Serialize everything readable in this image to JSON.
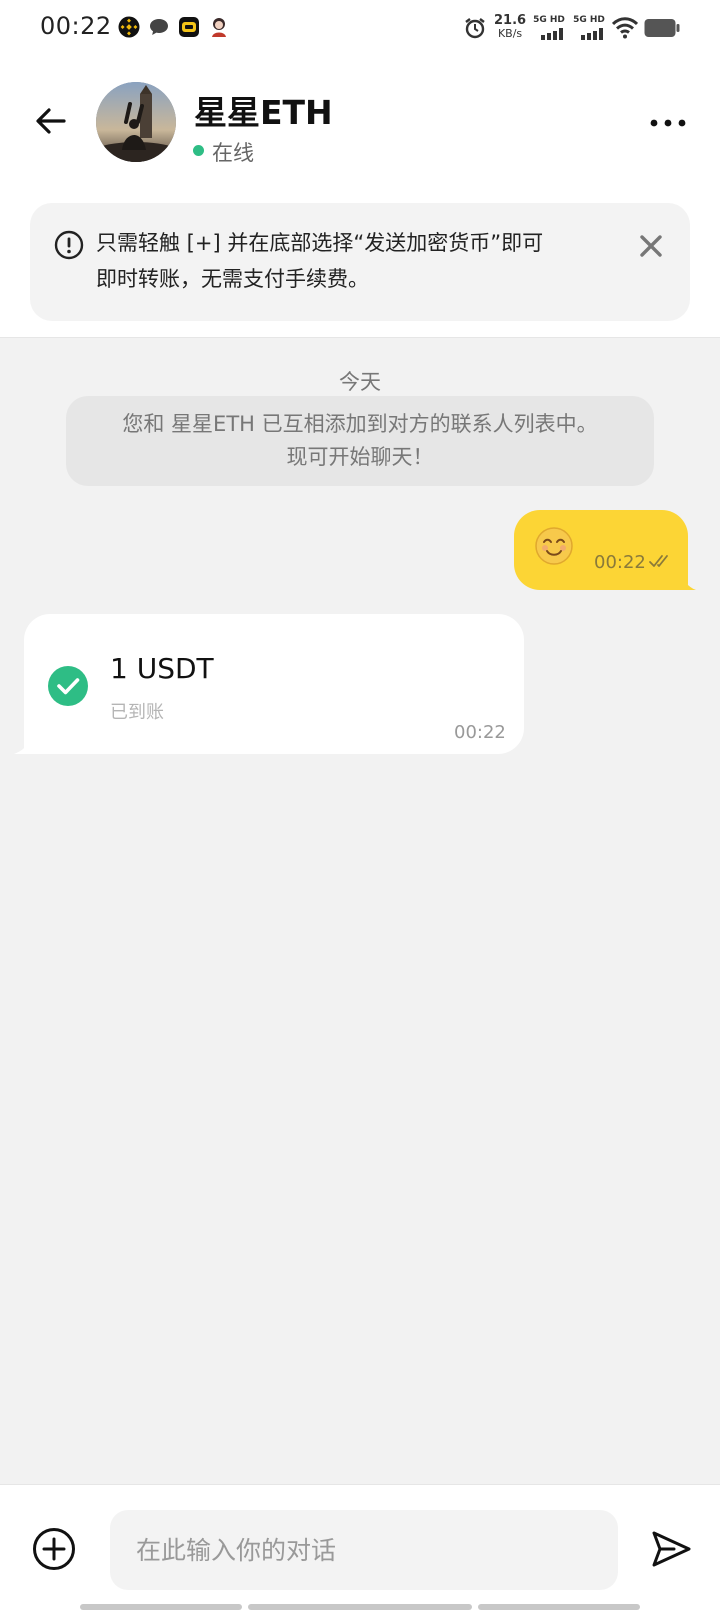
{
  "status_bar": {
    "time": "00:22",
    "net_speed": "21.6",
    "net_unit": "KB/s",
    "sim1_label": "5G HD",
    "sim2_label": "5G HD",
    "icons": [
      "binance-icon",
      "message-icon",
      "car-app-icon",
      "avatar-notification-icon",
      "alarm-icon",
      "signal-icon",
      "wifi-icon",
      "battery-icon"
    ]
  },
  "header": {
    "title": "星星ETH",
    "presence": "在线",
    "presence_color": "#2ebd85"
  },
  "notice": {
    "line1": "只需轻触 [+] 并在底部选择“发送加密货币”即可",
    "line2": "即时转账，无需支付手续费。"
  },
  "chat": {
    "date_label": "今天",
    "system_line1": "您和 星星ETH 已互相添加到对方的联系人列表中。",
    "system_line2": "现可开始聊天！",
    "outgoing": {
      "content": "smiling-face-emoji",
      "time": "00:22",
      "status": "read"
    },
    "incoming": {
      "amount": "1 USDT",
      "status_text": "已到账",
      "time": "00:22"
    }
  },
  "composer": {
    "placeholder": "在此输入你的对话"
  },
  "colors": {
    "accent": "#fcd535",
    "success": "#2ebd85",
    "background": "#f2f2f2"
  }
}
